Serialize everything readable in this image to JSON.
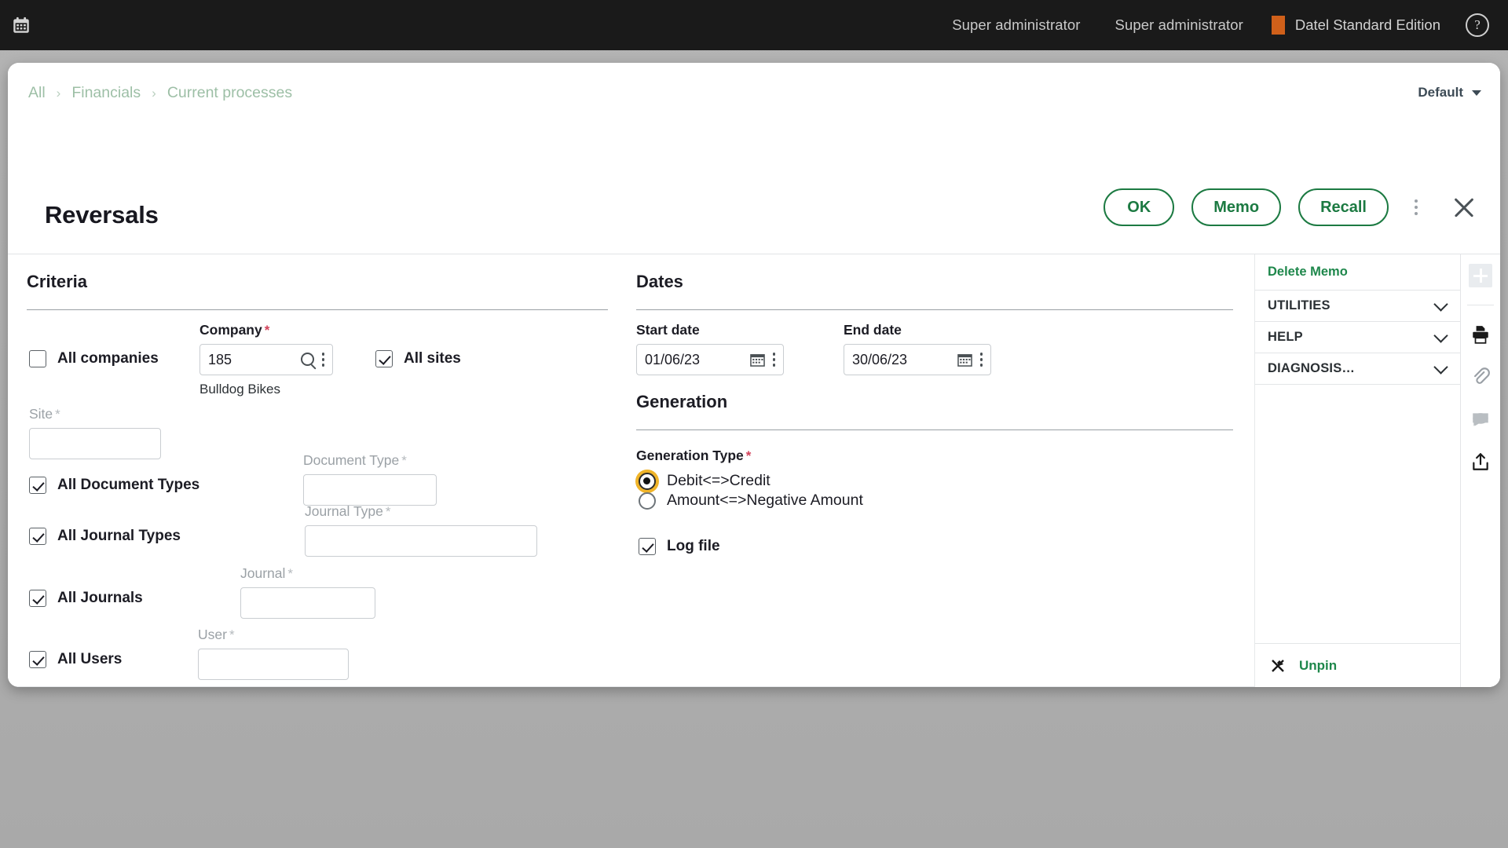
{
  "topbar": {
    "app_icon": "calendar-icon",
    "links": [
      "Super administrator",
      "Super administrator"
    ],
    "edition": "Datel Standard Edition",
    "edition_swatch_color": "#d0601a",
    "help_icon": "help-circle-icon",
    "background_color": "#1a1a1a"
  },
  "breadcrumb": {
    "items": [
      "All",
      "Financials",
      "Current processes"
    ],
    "separator": "›",
    "color": "#9dbfa6"
  },
  "view_selector": {
    "label": "Default"
  },
  "header": {
    "title": "Reversals",
    "buttons": [
      {
        "label": "OK",
        "name": "ok-button"
      },
      {
        "label": "Memo",
        "name": "memo-button"
      },
      {
        "label": "Recall",
        "name": "recall-button"
      }
    ],
    "accent_color": "#1c7a42",
    "more_icon": "kebab-menu-icon",
    "close_icon": "close-icon"
  },
  "criteria": {
    "section_title": "Criteria",
    "all_companies": {
      "label": "All companies",
      "checked": false
    },
    "company": {
      "label": "Company",
      "required": true,
      "value": "185",
      "helper_text": "Bulldog Bikes",
      "search_icon": "search-icon",
      "options_icon": "kebab-menu-icon"
    },
    "all_sites": {
      "label": "All sites",
      "checked": true
    },
    "site": {
      "label": "Site",
      "required": true,
      "value": "",
      "disabled": true
    },
    "all_document_types": {
      "label": "All Document Types",
      "checked": true
    },
    "document_type": {
      "label": "Document Type",
      "required": true,
      "value": "",
      "disabled": true
    },
    "all_journal_types": {
      "label": "All Journal Types",
      "checked": true
    },
    "journal_type": {
      "label": "Journal Type",
      "required": true,
      "value": "",
      "disabled": true
    },
    "all_journals": {
      "label": "All Journals",
      "checked": true
    },
    "journal": {
      "label": "Journal",
      "required": true,
      "value": "",
      "disabled": true
    },
    "all_users": {
      "label": "All Users",
      "checked": true
    },
    "user": {
      "label": "User",
      "required": true,
      "value": "",
      "disabled": true
    }
  },
  "dates": {
    "section_title": "Dates",
    "start_date": {
      "label": "Start date",
      "value": "01/06/23",
      "calendar_icon": "calendar-icon"
    },
    "end_date": {
      "label": "End date",
      "value": "30/06/23",
      "calendar_icon": "calendar-icon"
    }
  },
  "generation": {
    "section_title": "Generation",
    "type_label": "Generation Type",
    "type_required": true,
    "options": [
      {
        "label": "Debit<=>Credit",
        "selected": true
      },
      {
        "label": "Amount<=>Negative Amount",
        "selected": false
      }
    ],
    "focus_ring_color": "#f0b429",
    "log_file": {
      "label": "Log file",
      "checked": true
    }
  },
  "sidebar": {
    "delete_memo": "Delete Memo",
    "sections": [
      {
        "label": "UTILITIES",
        "expanded": false
      },
      {
        "label": "HELP",
        "expanded": false
      },
      {
        "label": "DIAGNOSIS…",
        "expanded": false
      }
    ],
    "unpin": "Unpin",
    "link_color": "#1e874b",
    "rail": [
      {
        "name": "add-icon"
      },
      {
        "name": "print-icon"
      },
      {
        "name": "attachment-icon"
      },
      {
        "name": "comment-icon"
      },
      {
        "name": "share-icon"
      }
    ]
  }
}
